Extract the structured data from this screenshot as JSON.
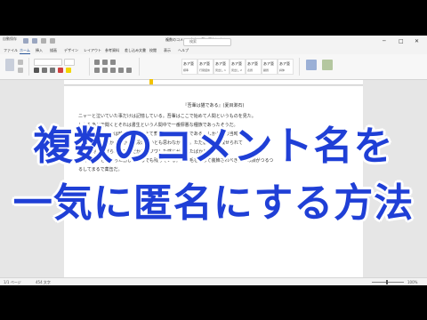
{
  "titlebar": {
    "autosave": "自動保存",
    "toggle": "オフ",
    "document_name": "複数のコメント名を一気に匿名にする",
    "search_placeholder": "検索",
    "minimize": "─",
    "maximize": "□",
    "close": "✕"
  },
  "tabs": [
    "ファイル",
    "ホーム",
    "挿入",
    "描画",
    "デザイン",
    "レイアウト",
    "参考資料",
    "差し込み文書",
    "校閲",
    "表示",
    "ヘルプ"
  ],
  "ribbon_styles": [
    {
      "sample": "あア亜",
      "caption": "標準"
    },
    {
      "sample": "あア亜",
      "caption": "行間詰め"
    },
    {
      "sample": "あア亜",
      "caption": "見出し 1"
    },
    {
      "sample": "あア亜",
      "caption": "見出し 2"
    },
    {
      "sample": "あア亜",
      "caption": "表題"
    },
    {
      "sample": "あア亜",
      "caption": "副題"
    },
    {
      "sample": "あア亜",
      "caption": "斜体"
    }
  ],
  "document": {
    "title_line": "『吾輩は猫である』(夏目漱石)",
    "lines": [
      "ニャーと泣いていた事だけは記憶している。吾輩はここで始めて人間というものを見た。",
      "しかもあとで聞くとそれは書生という人間中で一番獰悪な種族であったそうだ。",
      "この書生というのは時々我々を捕えて煮て食うという話である。しかしその当時は",
      "何という考もなかったから別段恐しいとも思わなかった。ただ彼の掌に載せられて",
      "スーと持ち上げられた時何だかフワフワした感じがあったばかりである。",
      "時計なんかどを持った感じがするでも残っている。第一毛をもって装飾されべきはずの顔がつるつ",
      "るしてまるで薬缶だ。"
    ]
  },
  "status": {
    "page": "1/1 ページ",
    "words": "454 文字",
    "zoom": "100%"
  },
  "overlay": {
    "line1": "複数のコメント名を",
    "line2": "一気に匿名にする方法"
  },
  "colors": {
    "overlay_text": "#1f3fd6",
    "overlay_stroke": "#ffffff",
    "accent": "#2b579a"
  }
}
